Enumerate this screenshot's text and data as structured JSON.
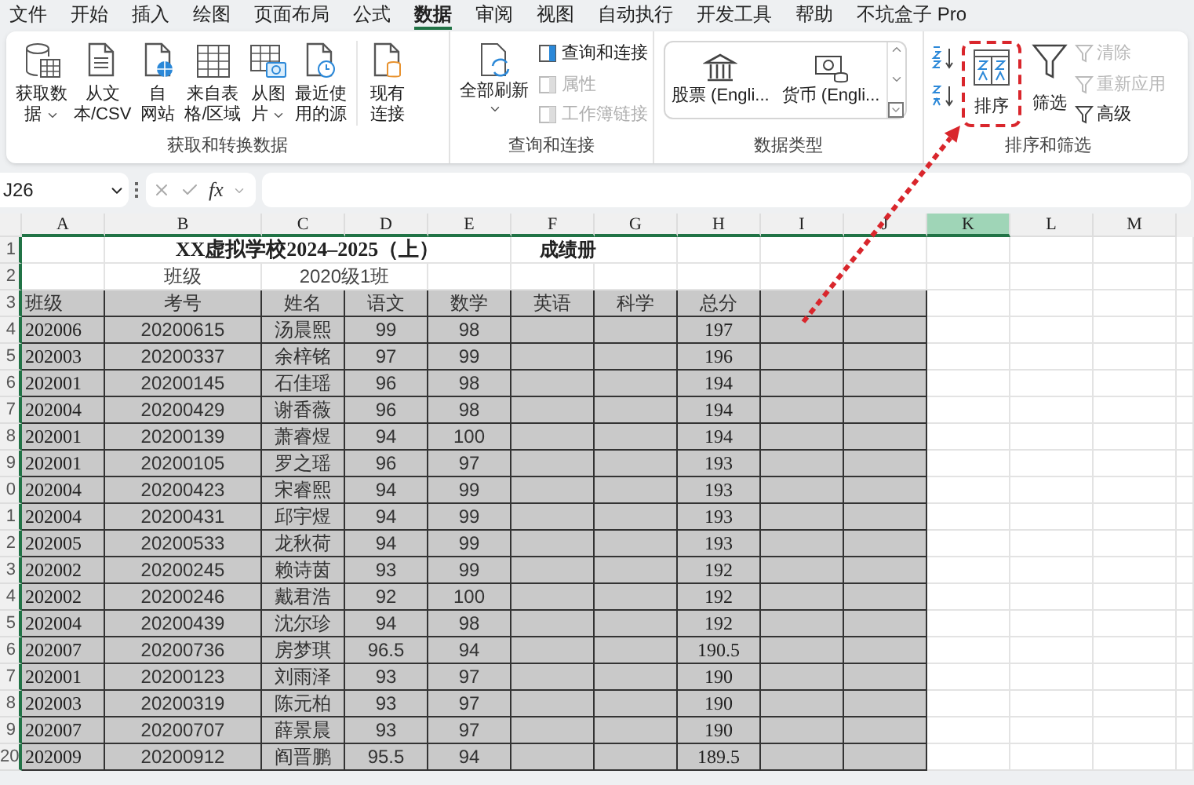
{
  "menu_tabs": [
    {
      "label": "文件",
      "selected": false
    },
    {
      "label": "开始",
      "selected": false
    },
    {
      "label": "插入",
      "selected": false
    },
    {
      "label": "绘图",
      "selected": false
    },
    {
      "label": "页面布局",
      "selected": false
    },
    {
      "label": "公式",
      "selected": false
    },
    {
      "label": "数据",
      "selected": true
    },
    {
      "label": "审阅",
      "selected": false
    },
    {
      "label": "视图",
      "selected": false
    },
    {
      "label": "自动执行",
      "selected": false
    },
    {
      "label": "开发工具",
      "selected": false
    },
    {
      "label": "帮助",
      "selected": false
    },
    {
      "label": "不坑盒子 Pro",
      "selected": false
    }
  ],
  "get_transform": {
    "title": "获取和转换数据",
    "buttons": [
      {
        "kind": "database",
        "lines": [
          "获取数",
          "据"
        ],
        "dropdown": true
      },
      {
        "kind": "text-file",
        "lines": [
          "从文",
          "本/CSV"
        ],
        "dropdown": false
      },
      {
        "kind": "web",
        "lines": [
          "自",
          "网站"
        ],
        "dropdown": false
      },
      {
        "kind": "table",
        "lines": [
          "来自表",
          "格/区域"
        ],
        "dropdown": false
      },
      {
        "kind": "picture",
        "lines": [
          "从图",
          "片"
        ],
        "dropdown": true
      },
      {
        "kind": "recent",
        "lines": [
          "最近使",
          "用的源"
        ],
        "dropdown": false
      },
      {
        "kind": "connection",
        "lines": [
          "现有",
          "连接"
        ],
        "dropdown": false
      }
    ]
  },
  "queries": {
    "title": "查询和连接",
    "refresh": {
      "label": "全部刷新",
      "dropdown": true
    },
    "items": [
      {
        "label": "查询和连接",
        "disabled": false
      },
      {
        "label": "属性",
        "disabled": true
      },
      {
        "label": "工作簿链接",
        "disabled": true
      }
    ]
  },
  "data_types": {
    "title": "数据类型",
    "items": [
      {
        "kind": "bank",
        "label": "股票 (Engli..."
      },
      {
        "kind": "currency",
        "label": "货币 (Engli..."
      }
    ]
  },
  "sort_filter": {
    "title": "排序和筛选",
    "sort": {
      "label": "排序",
      "highlighted": true
    },
    "filter": {
      "label": "筛选"
    },
    "items": [
      {
        "label": "清除",
        "disabled": true
      },
      {
        "label": "重新应用",
        "disabled": true
      },
      {
        "label": "高级",
        "disabled": false
      }
    ]
  },
  "formula_bar": {
    "name_box": "J26",
    "fx": "fx"
  },
  "sheet": {
    "columns": [
      {
        "label": "A",
        "selected": false
      },
      {
        "label": "B",
        "selected": false
      },
      {
        "label": "C",
        "selected": false
      },
      {
        "label": "D",
        "selected": false
      },
      {
        "label": "E",
        "selected": false
      },
      {
        "label": "F",
        "selected": false
      },
      {
        "label": "G",
        "selected": false
      },
      {
        "label": "H",
        "selected": false
      },
      {
        "label": "I",
        "selected": false
      },
      {
        "label": "J",
        "selected": false
      },
      {
        "label": "K",
        "selected": true
      },
      {
        "label": "L",
        "selected": false
      },
      {
        "label": "M",
        "selected": false
      }
    ],
    "row_numbers": [
      "1",
      "2",
      "3",
      "4",
      "5",
      "6",
      "7",
      "8",
      "9",
      "0",
      "1",
      "2",
      "3",
      "4",
      "5",
      "6",
      "7",
      "8",
      "9",
      "20"
    ],
    "title": "XX虚拟学校2024–2025（上）",
    "subtitle": "成绩册",
    "class_label": "班级",
    "class_value": "2020级1班",
    "headers": [
      "班级",
      "考号",
      "姓名",
      "语文",
      "数学",
      "英语",
      "科学",
      "总分"
    ],
    "rows": [
      {
        "cls": "202006",
        "id": "20200615",
        "name": "汤晨熙",
        "chinese": "99",
        "math": "98",
        "total": "197"
      },
      {
        "cls": "202003",
        "id": "20200337",
        "name": "余梓铭",
        "chinese": "97",
        "math": "99",
        "total": "196"
      },
      {
        "cls": "202001",
        "id": "20200145",
        "name": "石佳瑶",
        "chinese": "96",
        "math": "98",
        "total": "194"
      },
      {
        "cls": "202004",
        "id": "20200429",
        "name": "谢香薇",
        "chinese": "96",
        "math": "98",
        "total": "194"
      },
      {
        "cls": "202001",
        "id": "20200139",
        "name": "萧睿煜",
        "chinese": "94",
        "math": "100",
        "total": "194"
      },
      {
        "cls": "202001",
        "id": "20200105",
        "name": "罗之瑶",
        "chinese": "96",
        "math": "97",
        "total": "193"
      },
      {
        "cls": "202004",
        "id": "20200423",
        "name": "宋睿熙",
        "chinese": "94",
        "math": "99",
        "total": "193"
      },
      {
        "cls": "202004",
        "id": "20200431",
        "name": "邱宇煜",
        "chinese": "94",
        "math": "99",
        "total": "193"
      },
      {
        "cls": "202005",
        "id": "20200533",
        "name": "龙秋荷",
        "chinese": "94",
        "math": "99",
        "total": "193"
      },
      {
        "cls": "202002",
        "id": "20200245",
        "name": "赖诗茵",
        "chinese": "93",
        "math": "99",
        "total": "192"
      },
      {
        "cls": "202002",
        "id": "20200246",
        "name": "戴君浩",
        "chinese": "92",
        "math": "100",
        "total": "192"
      },
      {
        "cls": "202004",
        "id": "20200439",
        "name": "沈尔珍",
        "chinese": "94",
        "math": "98",
        "total": "192"
      },
      {
        "cls": "202007",
        "id": "20200736",
        "name": "房梦琪",
        "chinese": "96.5",
        "math": "94",
        "total": "190.5"
      },
      {
        "cls": "202001",
        "id": "20200123",
        "name": "刘雨泽",
        "chinese": "93",
        "math": "97",
        "total": "190"
      },
      {
        "cls": "202003",
        "id": "20200319",
        "name": "陈元柏",
        "chinese": "93",
        "math": "97",
        "total": "190"
      },
      {
        "cls": "202007",
        "id": "20200707",
        "name": "薛景晨",
        "chinese": "93",
        "math": "97",
        "total": "190"
      },
      {
        "cls": "202009",
        "id": "20200912",
        "name": "阎晋鹏",
        "chinese": "95.5",
        "math": "94",
        "total": "189.5"
      }
    ]
  }
}
